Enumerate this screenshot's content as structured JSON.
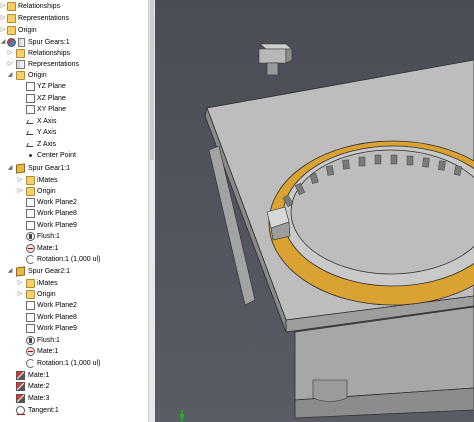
{
  "browser": {
    "items": [
      {
        "label": "Relationships",
        "icon": "relationships-folder-icon",
        "level": 1
      },
      {
        "label": "Representations",
        "icon": "representations-folder-icon",
        "level": 1
      },
      {
        "label": "Origin",
        "icon": "origin-folder-icon",
        "level": 1
      },
      {
        "label": "Spur Gears:1",
        "icon": "subassembly-icon",
        "level": 0
      },
      {
        "label": "Relationships",
        "icon": "relationships-folder-icon",
        "level": 1
      },
      {
        "label": "Representations",
        "icon": "representations-folder-icon",
        "level": 1
      },
      {
        "label": "Origin",
        "icon": "origin-folder-icon",
        "level": 1
      },
      {
        "label": "YZ Plane",
        "icon": "plane-icon",
        "level": 2
      },
      {
        "label": "XZ Plane",
        "icon": "plane-icon",
        "level": 2
      },
      {
        "label": "XY Plane",
        "icon": "plane-icon",
        "level": 2
      },
      {
        "label": "X Axis",
        "icon": "axis-icon",
        "level": 2
      },
      {
        "label": "Y Axis",
        "icon": "axis-icon",
        "level": 2
      },
      {
        "label": "Z Axis",
        "icon": "axis-icon",
        "level": 2
      },
      {
        "label": "Center Point",
        "icon": "center-point-icon",
        "level": 2
      },
      {
        "label": "Spur Gear1:1",
        "icon": "part-icon",
        "level": 1
      },
      {
        "label": "iMates",
        "icon": "imates-folder-icon",
        "level": 2
      },
      {
        "label": "Origin",
        "icon": "origin-folder-icon",
        "level": 2
      },
      {
        "label": "Work Plane2",
        "icon": "work-plane-icon",
        "level": 2
      },
      {
        "label": "Work Plane8",
        "icon": "work-plane-icon",
        "level": 2
      },
      {
        "label": "Work Plane9",
        "icon": "work-plane-icon",
        "level": 2
      },
      {
        "label": "Flush:1",
        "icon": "flush-constraint-icon",
        "level": 2
      },
      {
        "label": "Mate:1",
        "icon": "mate-constraint-icon",
        "level": 2
      },
      {
        "label": "Rotation:1 (1,000 ul)",
        "icon": "rotation-constraint-icon",
        "level": 2
      },
      {
        "label": "Spur Gear2:1",
        "icon": "part-icon",
        "level": 1
      },
      {
        "label": "iMates",
        "icon": "imates-folder-icon",
        "level": 2
      },
      {
        "label": "Origin",
        "icon": "origin-folder-icon",
        "level": 2
      },
      {
        "label": "Work Plane2",
        "icon": "work-plane-icon",
        "level": 2
      },
      {
        "label": "Work Plane8",
        "icon": "work-plane-icon",
        "level": 2
      },
      {
        "label": "Work Plane9",
        "icon": "work-plane-icon",
        "level": 2
      },
      {
        "label": "Flush:1",
        "icon": "flush-constraint-icon",
        "level": 2
      },
      {
        "label": "Mate:1",
        "icon": "mate-constraint-icon",
        "level": 2
      },
      {
        "label": "Rotation:1 (1,000 ul)",
        "icon": "rotation-constraint-icon",
        "level": 2
      },
      {
        "label": "Mate:1",
        "icon": "mate-constraint-icon",
        "level": 1
      },
      {
        "label": "Mate:2",
        "icon": "mate-constraint-icon",
        "level": 1
      },
      {
        "label": "Mate:3",
        "icon": "mate-constraint-icon",
        "level": 1
      },
      {
        "label": "Tangent:1",
        "icon": "tangent-constraint-icon",
        "level": 1
      }
    ]
  },
  "colors": {
    "viewport_bg": "#555860",
    "plate": "#b9b9b9",
    "gear": "#d9a232"
  }
}
